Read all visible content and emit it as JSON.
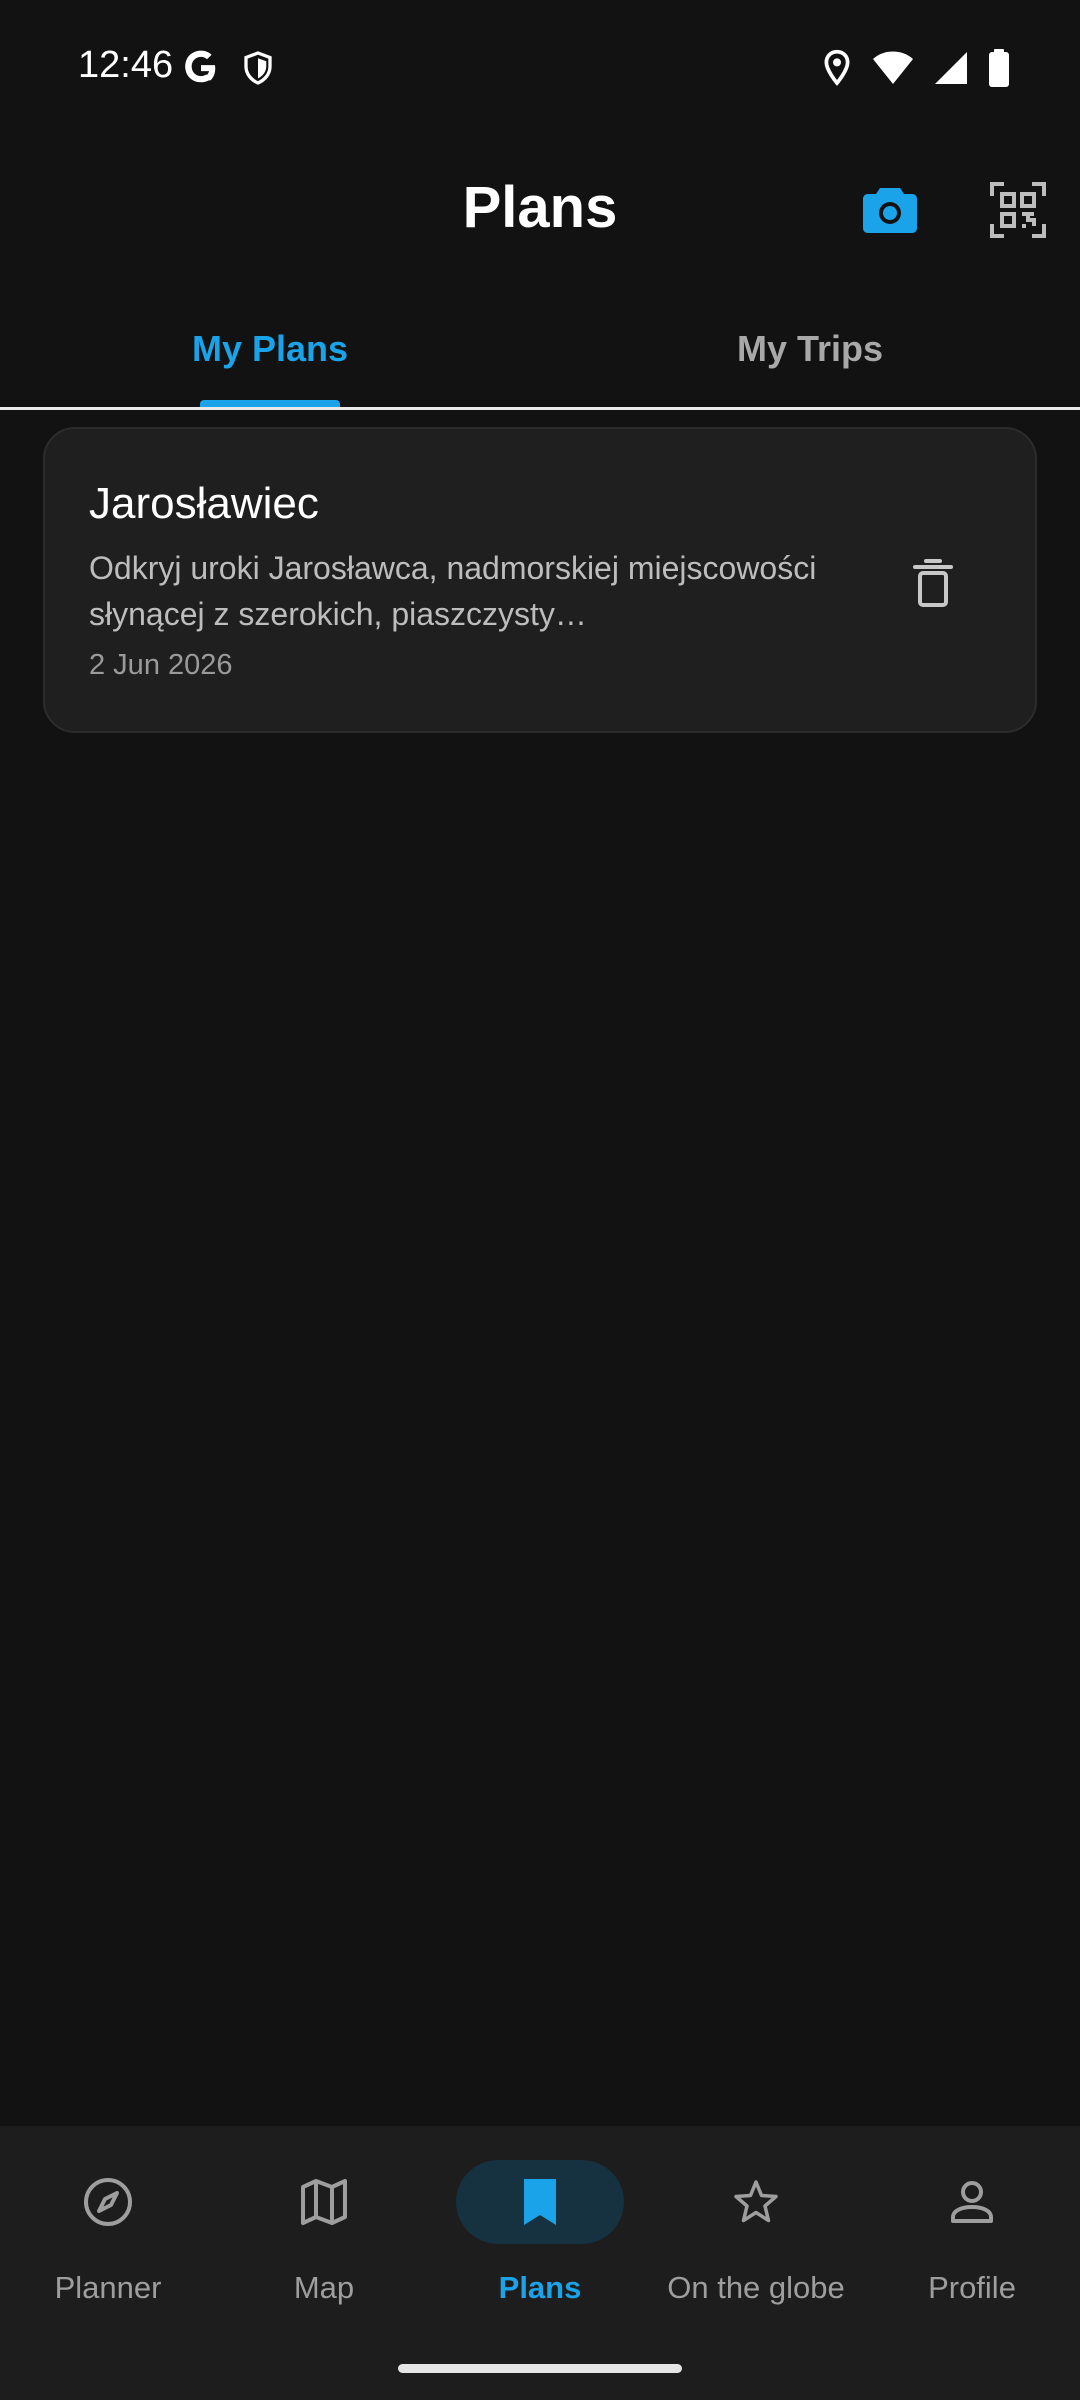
{
  "status_bar": {
    "time": "12:46",
    "icons": [
      "google-icon",
      "shield-icon",
      "location-icon",
      "wifi-icon",
      "signal-icon",
      "battery-icon"
    ]
  },
  "header": {
    "title": "Plans",
    "actions": [
      "camera-icon",
      "qr-code-icon"
    ]
  },
  "tabs": [
    {
      "label": "My Plans",
      "active": true
    },
    {
      "label": "My Trips",
      "active": false
    }
  ],
  "plans": [
    {
      "title": "Jarosławiec",
      "description": "Odkryj uroki Jarosławca, nadmorskiej miejscowości słynącej z szerokich, piaszczysty…",
      "date": "2 Jun 2026"
    }
  ],
  "bottom_nav": [
    {
      "label": "Planner",
      "icon": "compass-icon",
      "active": false
    },
    {
      "label": "Map",
      "icon": "map-icon",
      "active": false
    },
    {
      "label": "Plans",
      "icon": "bookmark-icon",
      "active": true
    },
    {
      "label": "On the globe",
      "icon": "star-icon",
      "active": false
    },
    {
      "label": "Profile",
      "icon": "person-icon",
      "active": false
    }
  ],
  "colors": {
    "background": "#121212",
    "accent": "#1aa3e8",
    "card": "#1f1f1f",
    "nav_background": "#1d1d1d"
  }
}
